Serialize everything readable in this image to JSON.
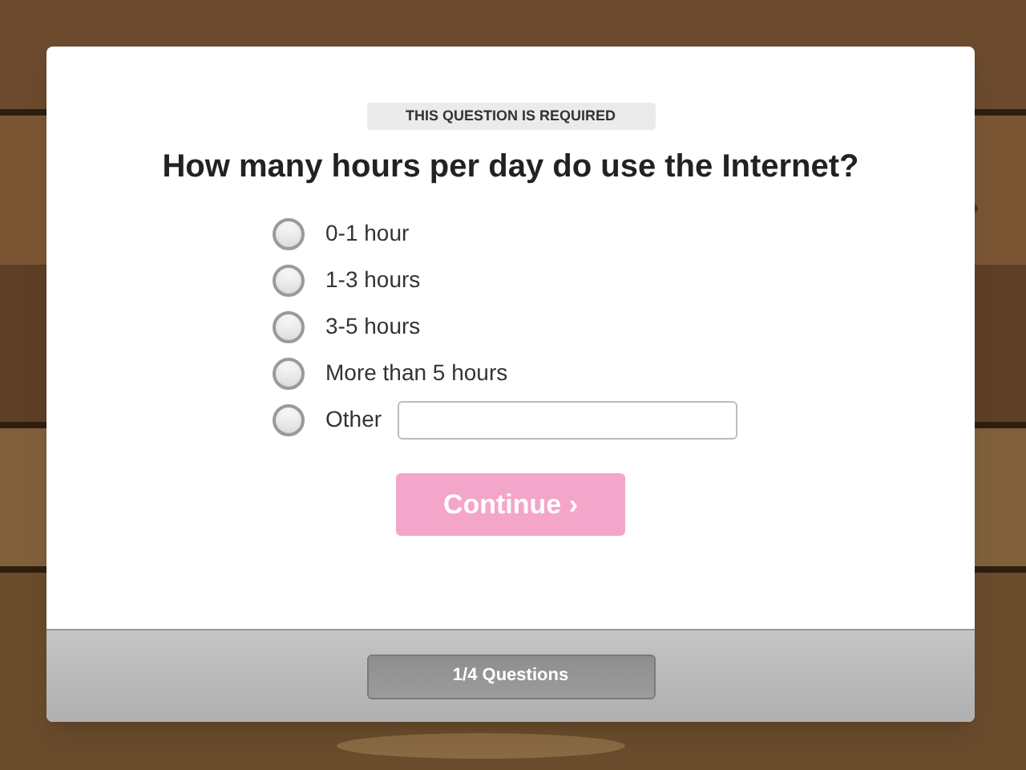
{
  "badge": "THIS QUESTION IS REQUIRED",
  "question": "How many hours per day do use the Internet?",
  "options": [
    {
      "kind": "choice",
      "label": "0-1 hour",
      "selected": false
    },
    {
      "kind": "choice",
      "label": "1-3 hours",
      "selected": false
    },
    {
      "kind": "choice",
      "label": "3-5 hours",
      "selected": false
    },
    {
      "kind": "choice",
      "label": "More than 5 hours",
      "selected": false
    },
    {
      "kind": "other",
      "label": "Other",
      "selected": false
    }
  ],
  "continue_button": {
    "label": "Continue ›",
    "disabled": true
  },
  "progress": {
    "label": "1/4 Questions"
  }
}
